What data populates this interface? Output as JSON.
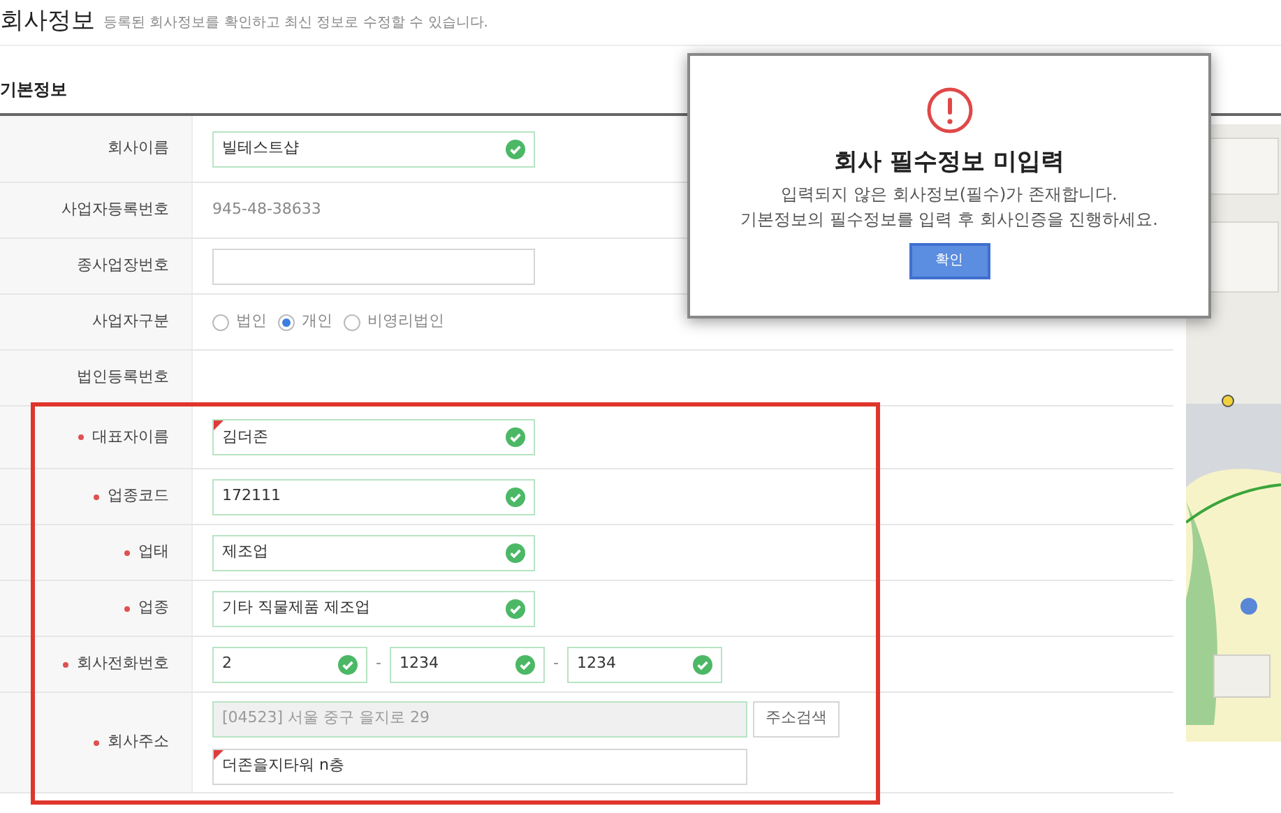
{
  "page": {
    "title": "회사정보",
    "subtitle": "등록된 회사정보를 확인하고 최신 정보로 수정할 수 있습니다."
  },
  "section": {
    "title": "기본정보"
  },
  "rows": [
    {
      "label": "회사이름",
      "required": false,
      "kind": "input",
      "value": "빌테스트샵",
      "valid": true,
      "flagged": false
    },
    {
      "label": "사업자등록번호",
      "required": false,
      "kind": "text",
      "value": "945-48-38633"
    },
    {
      "label": "종사업장번호",
      "required": false,
      "kind": "input",
      "valid": false,
      "flagged": false
    },
    {
      "label": "사업자구분",
      "required": false,
      "kind": "radio",
      "options": [
        {
          "label": "법인",
          "selected": false
        },
        {
          "label": "개인",
          "selected": true
        },
        {
          "label": "비영리법인",
          "selected": false
        }
      ]
    },
    {
      "label": "법인등록번호",
      "required": false,
      "kind": "empty"
    },
    {
      "label": "대표자이름",
      "required": true,
      "kind": "input",
      "value": "김더존",
      "valid": true,
      "flagged": true
    },
    {
      "label": "업종코드",
      "required": true,
      "kind": "input",
      "value": "172111",
      "valid": true,
      "flagged": false
    },
    {
      "label": "업태",
      "required": true,
      "kind": "input",
      "value": "제조업",
      "valid": true,
      "flagged": false
    },
    {
      "label": "업종",
      "required": true,
      "kind": "input",
      "value": "기타 직물제품 제조업",
      "valid": true,
      "flagged": false
    },
    {
      "label": "회사전화번호",
      "required": true,
      "kind": "phone",
      "separator": "-",
      "parts": [
        {
          "value": "2",
          "valid": true
        },
        {
          "value": "1234",
          "valid": true
        },
        {
          "value": "1234",
          "valid": true
        }
      ]
    },
    {
      "label": "회사주소",
      "required": true,
      "kind": "address",
      "address": "[04523] 서울 중구 을지로 29",
      "button": "주소검색",
      "detail": "더존을지타워 n층",
      "flagged": true
    }
  ],
  "dialog": {
    "title": "회사 필수정보 미입력",
    "message": [
      "입력되지 않은 회사정보(필수)가 존재합니다.",
      "기본정보의 필수정보를 입력 후 회사인증을 진행하세요."
    ],
    "button": "확인"
  }
}
